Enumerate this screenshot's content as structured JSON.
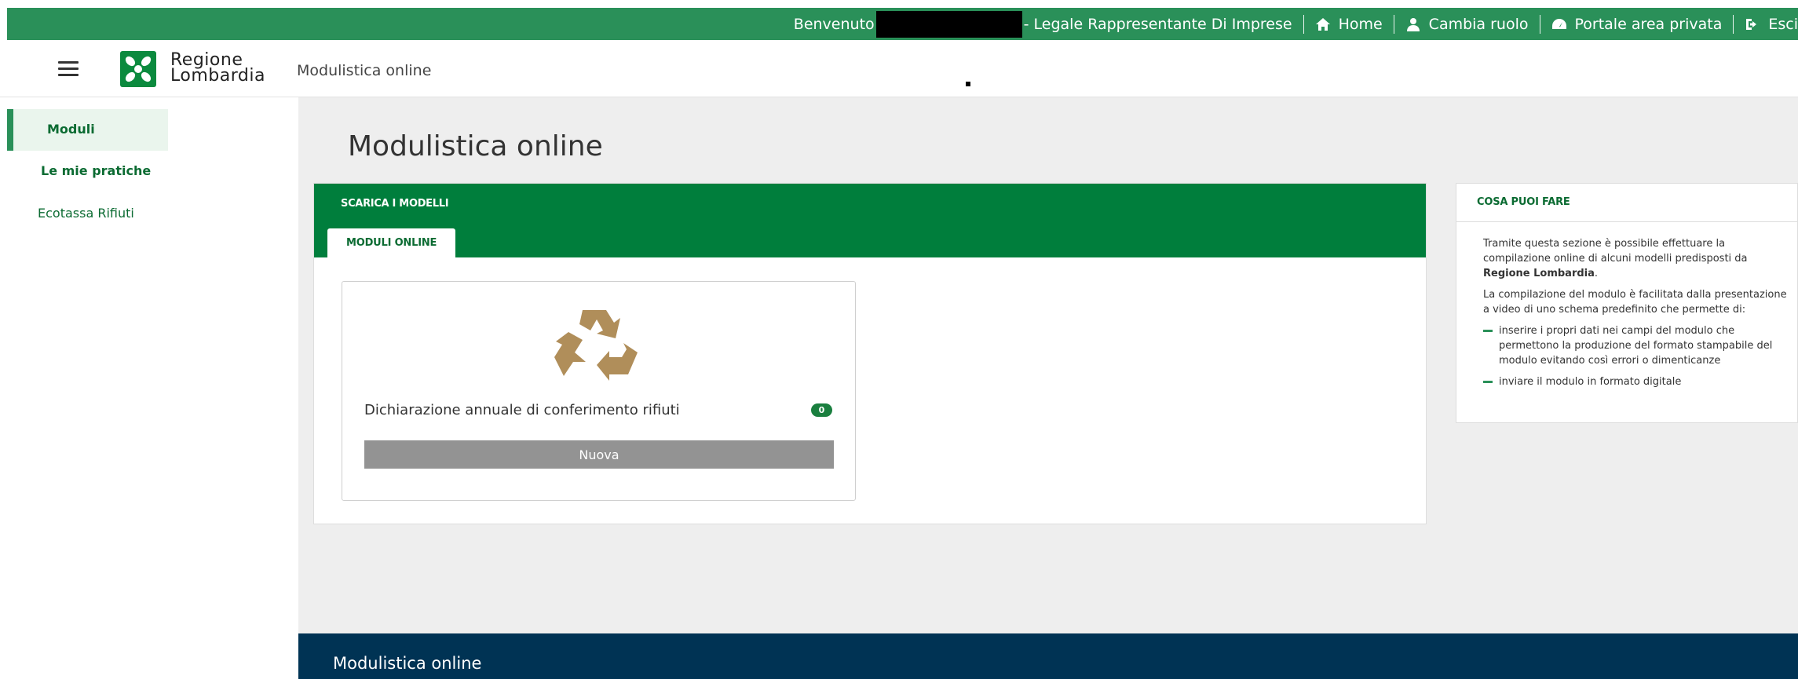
{
  "topbar": {
    "welcome": "Benvenuto",
    "role": "- Legale Rappresentante Di Imprese",
    "links": [
      {
        "icon": "home-icon",
        "label": "Home"
      },
      {
        "icon": "user-icon",
        "label": "Cambia ruolo"
      },
      {
        "icon": "dashboard-icon",
        "label": "Portale area privata"
      },
      {
        "icon": "logout-icon",
        "label": "Esci"
      }
    ]
  },
  "header": {
    "logo_line1": "Regione",
    "logo_line2": "Lombardia",
    "app_title": "Modulistica online"
  },
  "sidebar": {
    "items": [
      {
        "label": "Moduli",
        "active": true
      },
      {
        "label": "Le mie pratiche",
        "active": false
      },
      {
        "label": "Ecotassa Rifiuti",
        "active": false
      }
    ]
  },
  "main": {
    "page_title": "Modulistica online",
    "panel_title": "SCARICA I MODELLI",
    "tab_label": "MODULI ONLINE",
    "card": {
      "icon": "recycle-icon",
      "label": "Dichiarazione annuale di conferimento rifiuti",
      "count": "0",
      "button_label": "Nuova"
    }
  },
  "info": {
    "title": "COSA PUOI FARE",
    "p1_text": "Tramite questa sezione è possibile effettuare la compilazione online di alcuni modelli predisposti da ",
    "p1_bold": "Regione Lombardia",
    "p1_end": ".",
    "p2": "La compilazione del modulo è facilitata dalla presentazione a video di uno schema predefinito che permette di:",
    "bullets": [
      "inserire i propri dati nei campi del modulo che permettono la produzione del formato stampabile del modulo evitando così errori o dimenticanze",
      "inviare il modulo in formato digitale"
    ]
  },
  "footer": {
    "title": "Modulistica online"
  },
  "colors": {
    "topbar": "#2a9059",
    "panel_header": "#007e3c",
    "footer": "#003354",
    "recycle": "#b08e5a"
  }
}
